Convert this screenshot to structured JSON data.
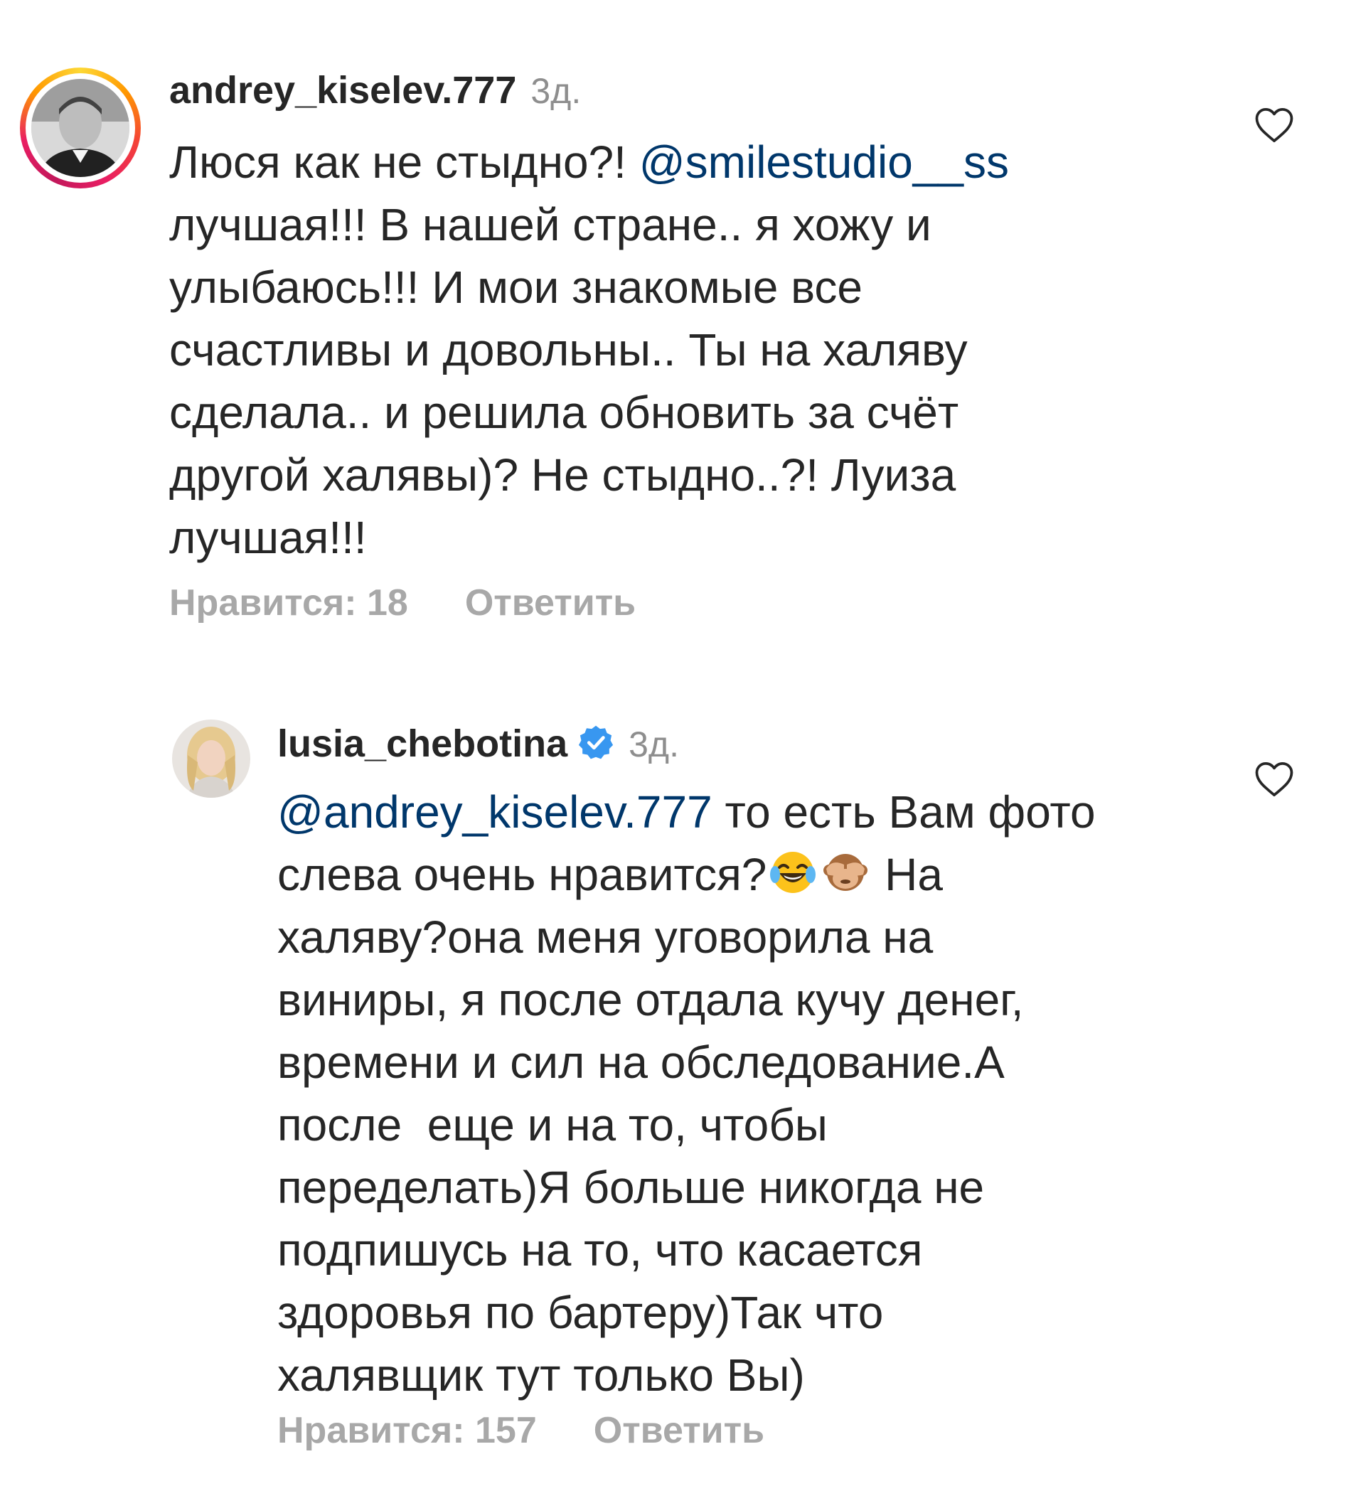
{
  "comments": [
    {
      "username": "andrey_kiselev.777",
      "time": "3д.",
      "text_before_mention": "Люся как не стыдно?! ",
      "mention": "@smilestudio__ss",
      "text_after_mention": "\nлучшая!!! В нашей стране.. я хожу и\nулыбаюсь!!! И мои знакомые все\nсчастливы и довольны.. Ты на халяву\nсделала.. и решила обновить за счёт\nдругой халявы)? Не стыдно..?! Луиза\nлучшая!!!",
      "likes_label": "Нравится: 18",
      "reply_label": "Ответить",
      "avatar_icon": "avatar-photo-man-bw",
      "like_icon": "heart-outline-icon"
    },
    {
      "username": "lusia_chebotina",
      "verified": true,
      "verified_icon": "verified-badge-icon",
      "verified_color": "#3897f0",
      "time": "3д.",
      "mention": "@andrey_kiselev.777",
      "text_line1_rest": " то есть Вам фото",
      "text_line2_start": "слева очень нравится?",
      "emoji_1": "😂",
      "emoji_2": "🙈",
      "text_line2_end": " На",
      "text_rest": "халяву?она меня уговорила на\nвиниры, я после отдала кучу денег,\nвремени и сил на обследование.А\nпосле  еще и на то, чтобы\nпеределать)Я больше никогда не\nподпишусь на то, что касается\nздоровья по бартеру)Так что\nхалявщик тут только Вы)",
      "likes_label": "Нравится: 157",
      "reply_label": "Ответить",
      "avatar_icon": "avatar-photo-woman-blonde",
      "like_icon": "heart-outline-icon"
    }
  ],
  "colors": {
    "text": "#262626",
    "secondary": "#8e8e8e",
    "actions": "#a8a8a8",
    "mention": "#00376b"
  }
}
